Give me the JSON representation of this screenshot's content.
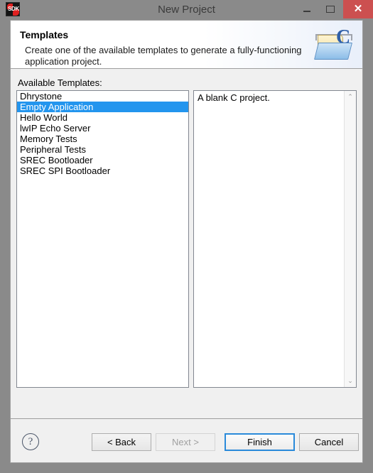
{
  "window": {
    "title": "New Project",
    "icon_name": "sdk-icon",
    "icon_text": "SDK",
    "controls": {
      "minimize": "minimize-icon",
      "maximize": "maximize-icon",
      "close": "✕"
    }
  },
  "header": {
    "title": "Templates",
    "description": "Create one of the available templates to generate a fully-functioning application project.",
    "icon_name": "c-project-folder-icon",
    "icon_letter": "C"
  },
  "main": {
    "list_label": "Available Templates:",
    "templates": [
      {
        "label": "Dhrystone",
        "selected": false
      },
      {
        "label": "Empty Application",
        "selected": true
      },
      {
        "label": "Hello World",
        "selected": false
      },
      {
        "label": "lwIP Echo Server",
        "selected": false
      },
      {
        "label": "Memory Tests",
        "selected": false
      },
      {
        "label": "Peripheral Tests",
        "selected": false
      },
      {
        "label": "SREC Bootloader",
        "selected": false
      },
      {
        "label": "SREC SPI Bootloader",
        "selected": false
      }
    ],
    "description_panel": {
      "text": "A blank C project.",
      "scroll_up": "⌃",
      "scroll_down": "⌄"
    }
  },
  "footer": {
    "help_label": "?",
    "buttons": {
      "back": "< Back",
      "next": "Next >",
      "finish": "Finish",
      "cancel": "Cancel"
    }
  },
  "colors": {
    "selection": "#2395ee",
    "title_bar": "#8a8a8a",
    "close_button": "#cc5050",
    "dialog_background": "#f0f0f0",
    "default_button_focus": "#2a8ada"
  }
}
